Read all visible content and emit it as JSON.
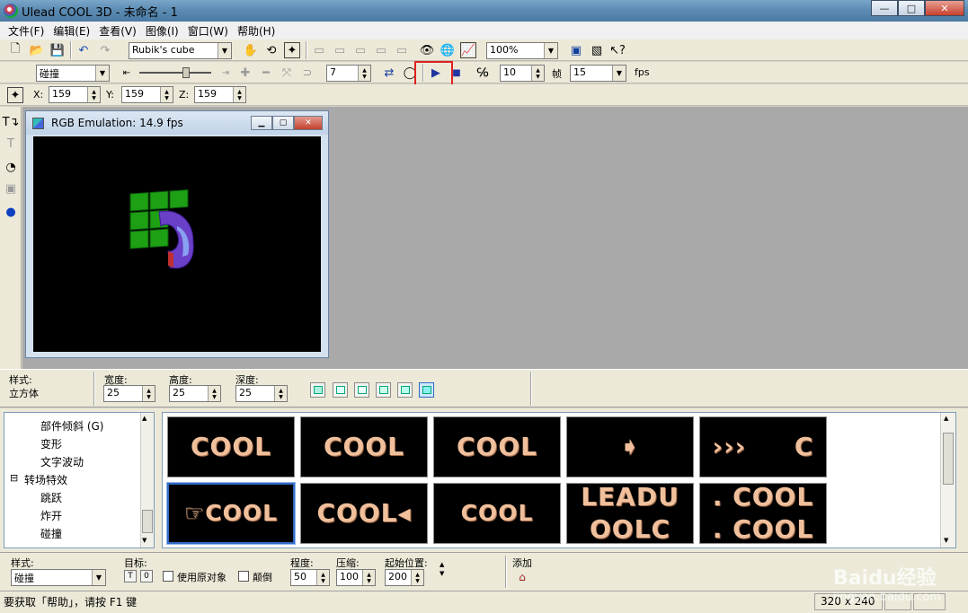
{
  "window": {
    "title": "Ulead COOL 3D - 未命名 - 1",
    "minimize": "—",
    "maximize": "□",
    "close": "✕"
  },
  "menu": [
    "文件(F)",
    "编辑(E)",
    "查看(V)",
    "图像(I)",
    "窗口(W)",
    "帮助(H)"
  ],
  "toolbar1": {
    "object_combo": "Rubik's cube",
    "zoom_combo": "100%"
  },
  "toolbar2": {
    "effect_combo": "碰撞",
    "frame_value": "7",
    "play_icon": "play-icon",
    "speed_value": "10",
    "frame_label": "帧",
    "fps_value": "15",
    "fps_label": "fps"
  },
  "toolbar3": {
    "x_label": "X:",
    "x_value": "159",
    "y_label": "Y:",
    "y_value": "159",
    "z_label": "Z:",
    "z_value": "159"
  },
  "preview": {
    "title": "RGB Emulation: 14.9 fps"
  },
  "attributes": {
    "style_label": "样式:",
    "style_value": "立方体",
    "width_label": "宽度:",
    "width_value": "25",
    "height_label": "高度:",
    "height_value": "25",
    "depth_label": "深度:",
    "depth_value": "25"
  },
  "tree": [
    {
      "label": "部件倾斜 (G)"
    },
    {
      "label": "变形"
    },
    {
      "label": "文字波动"
    },
    {
      "label": "转场特效",
      "expander": "⊟"
    },
    {
      "label": "跳跃"
    },
    {
      "label": "炸开"
    },
    {
      "label": "碰撞"
    }
  ],
  "thumbnails": [
    {
      "text": "COOL"
    },
    {
      "text": "COOL"
    },
    {
      "text": "COOL"
    },
    {
      "text": "➧"
    },
    {
      "text": "›››     C"
    },
    {
      "text": "☞COOL"
    },
    {
      "text": "COOL◂"
    },
    {
      "text": "COOL"
    },
    {
      "text": "LEADU\nOOLC"
    },
    {
      "text": ". COOL\n. COOL"
    }
  ],
  "properties": {
    "style_label": "样式:",
    "style_value": "碰撞",
    "target_label": "目标:",
    "target_t": "T",
    "target_o": "0",
    "use_original_label": "使用原对象",
    "reverse_label": "颠倒",
    "degree_label": "程度:",
    "degree_value": "50",
    "compress_label": "压缩:",
    "compress_value": "100",
    "start_label": "起始位置:",
    "start_value": "200",
    "add_label": "添加"
  },
  "status": {
    "help_text": "要获取「帮助」，请按 F1 键",
    "size": "320 x 240"
  },
  "watermark": {
    "brand": "Baidu经验",
    "url": "jingyan.baidu.com"
  },
  "colors": {
    "highlight": "#e02020",
    "thumb_text": "#f0c09c",
    "selection": "#316ac5"
  }
}
